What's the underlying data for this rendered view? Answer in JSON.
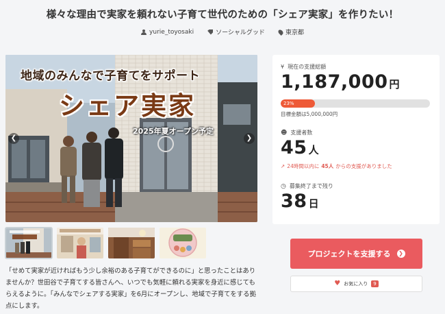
{
  "page": {
    "title": "様々な理由で実家を頼れない子育て世代のための「シェア実家」を作りたい！"
  },
  "meta": {
    "author": "yurie_toyosaki",
    "category": "ソーシャルグッド",
    "location": "東京都",
    "icons": [
      "user-icon",
      "tag-icon",
      "location-pin-icon"
    ]
  },
  "hero": {
    "line1": "地域のみんなで子育てをサポート",
    "line2": "シェア実家",
    "line3": "2025年夏オープン予定",
    "prev_icon": "chevron-left-icon",
    "next_icon": "chevron-right-icon"
  },
  "thumbnails": [
    {
      "name": "thumbnail-1",
      "active": true
    },
    {
      "name": "thumbnail-2",
      "active": false
    },
    {
      "name": "thumbnail-3",
      "active": false
    },
    {
      "name": "thumbnail-4",
      "active": false
    }
  ],
  "description": "「せめて実家が近ければもう少し余裕のある子育てができるのに」と思ったことはありませんか？世田谷で子育てする皆さんへ、いつでも気軽に頼れる実家を身近に感じてもらえるように。「みんなでシェアする実家」を6月にオープンし、地域で子育てをする拠点にします。",
  "stats": {
    "total_label": "現在の支援総額",
    "total_value": "1,187,000",
    "total_unit": "円",
    "progress_percent": 23,
    "progress_text": "23%",
    "goal_text": "目標金額は5,000,000円",
    "supporters_label": "支援者数",
    "supporters_value": "45",
    "supporters_unit": "人",
    "trend_prefix": "24時間以内に",
    "trend_count": "45人",
    "trend_suffix": "からの支援がありました",
    "remaining_label": "募集終了まで残り",
    "remaining_value": "38",
    "remaining_unit": "日"
  },
  "actions": {
    "support_label": "プロジェクトを支援する",
    "favorite_label": "お気に入り",
    "favorite_count": "9"
  },
  "colors": {
    "accent": "#ea5b5f",
    "progress": "#ee5a37",
    "background": "#f4f5f7"
  }
}
